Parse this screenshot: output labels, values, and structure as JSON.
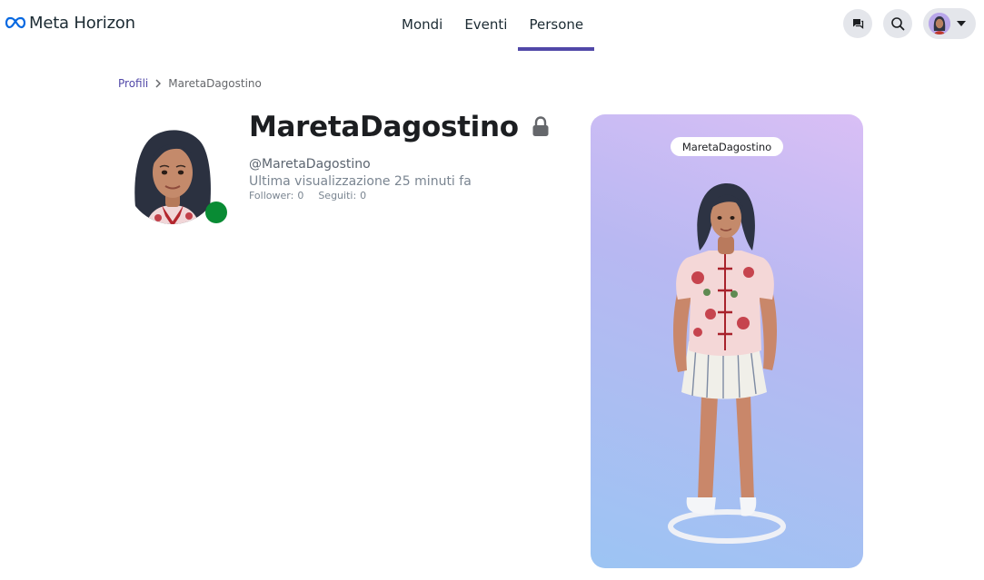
{
  "header": {
    "logo_text": "Meta Horizon",
    "nav": [
      {
        "label": "Mondi",
        "active": false
      },
      {
        "label": "Eventi",
        "active": false
      },
      {
        "label": "Persone",
        "active": true
      }
    ],
    "icons": [
      "chat-icon",
      "search-icon",
      "caret-down-icon"
    ],
    "accent_color": "#5148a8"
  },
  "breadcrumb": {
    "parent": "Profili",
    "current": "MaretaDagostino"
  },
  "profile": {
    "name": "MaretaDagostino",
    "handle": "@MaretaDagostino",
    "last_seen": "Ultima visualizzazione 25 minuti fa",
    "followers_label": "Follower:",
    "followers_count": "0",
    "following_label": "Seguiti:",
    "following_count": "0",
    "online_color": "#098b34",
    "private_icon": "lock-icon"
  },
  "avatar_card": {
    "name_tag": "MaretaDagostino"
  }
}
